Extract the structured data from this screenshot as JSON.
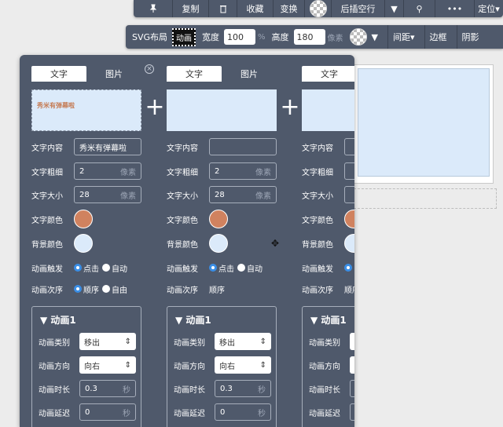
{
  "topbar": {
    "items": [
      {
        "icon": "pin-icon",
        "label": ""
      },
      {
        "label": "复制"
      },
      {
        "icon": "trash-icon",
        "label": ""
      },
      {
        "label": "收藏"
      },
      {
        "label": "变换"
      },
      {
        "icon": "checker-icon",
        "label": ""
      },
      {
        "label": "后插空行"
      },
      {
        "icon": "caret-down-icon",
        "label": ""
      },
      {
        "icon": "link-icon",
        "label": ""
      },
      {
        "label": "•••"
      },
      {
        "label": "定位"
      }
    ]
  },
  "svgbar": {
    "title": "SVG布局",
    "anim_button": "动画",
    "width_label": "宽度",
    "width_value": "100",
    "width_unit": "%",
    "height_label": "高度",
    "height_value": "180",
    "height_unit": "像素",
    "spacing_label": "间距",
    "border_label": "边框",
    "shadow_label": "阴影"
  },
  "labels": {
    "tab_text": "文字",
    "tab_image": "图片",
    "text_content": "文字内容",
    "text_weight": "文字粗细",
    "text_size": "文字大小",
    "text_color": "文字颜色",
    "bg_color": "背景颜色",
    "anim_trigger": "动画触发",
    "anim_order": "动画次序",
    "unit_px": "像素",
    "unit_s": "秒",
    "click": "点击",
    "auto": "自动",
    "sequential": "顺序",
    "free": "自由",
    "anim_header": "▼ 动画1",
    "anim_type": "动画类别",
    "anim_dir": "动画方向",
    "anim_dur": "动画时长",
    "anim_delay": "动画延迟",
    "plus": "+"
  },
  "columns": [
    {
      "preview_text": "秀米有弹幕啦",
      "text_content": "秀米有弹幕啦",
      "weight": "2",
      "size": "28",
      "text_color": "#d0825f",
      "bg_color": "#dbeafa",
      "anim_type": "移出",
      "anim_dir": "向右",
      "anim_dur": "0.3",
      "anim_delay": "0"
    },
    {
      "preview_text": "",
      "text_content": "",
      "weight": "2",
      "size": "28",
      "text_color": "#d0825f",
      "bg_color": "#dbeafa",
      "order_text": "顺序",
      "anim_type": "移出",
      "anim_dir": "向右",
      "anim_dur": "0.3",
      "anim_delay": "0"
    },
    {
      "preview_text": "",
      "text_content": "",
      "text_color": "#d0825f",
      "bg_color": "#dbeafa",
      "order_text": "顺序"
    }
  ]
}
